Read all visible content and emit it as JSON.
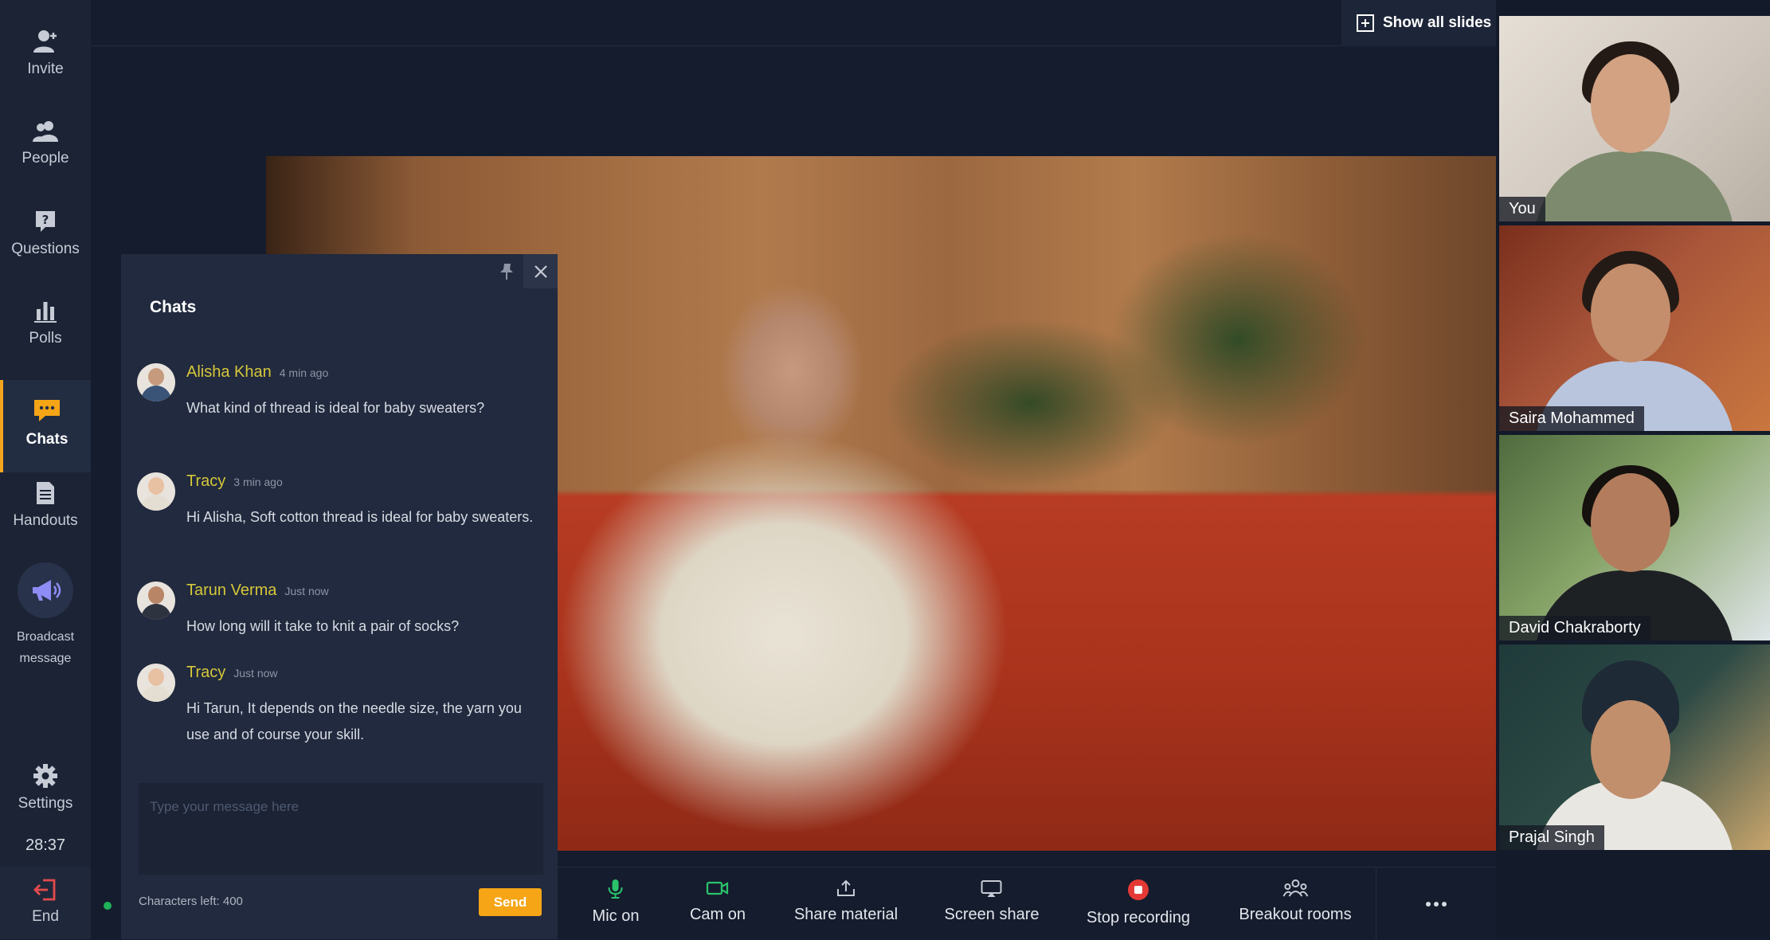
{
  "sidebar": {
    "items": [
      {
        "label": "Invite",
        "icon": "invite-icon"
      },
      {
        "label": "People",
        "icon": "people-icon"
      },
      {
        "label": "Questions",
        "icon": "question-icon"
      },
      {
        "label": "Polls",
        "icon": "polls-icon"
      },
      {
        "label": "Chats",
        "icon": "chat-icon",
        "active": true
      },
      {
        "label": "Handouts",
        "icon": "handouts-icon"
      }
    ],
    "broadcast": {
      "line1": "Broadcast",
      "line2": "message",
      "icon": "megaphone-icon"
    },
    "settings": {
      "label": "Settings",
      "icon": "gear-icon"
    },
    "timer": "28:37",
    "end": {
      "label": "End",
      "icon": "exit-icon"
    }
  },
  "topbar": {
    "show_all_slides": "Show all slides"
  },
  "chat": {
    "title": "Chats",
    "messages": [
      {
        "name": "Alisha Khan",
        "time": "4 min ago",
        "text": "What kind of thread is ideal for baby sweaters?"
      },
      {
        "name": "Tracy",
        "time": "3 min ago",
        "text": "Hi Alisha, Soft cotton thread is ideal for baby sweaters."
      },
      {
        "name": "Tarun Verma",
        "time": "Just now",
        "text": "How long will it take to knit a pair of socks?"
      },
      {
        "name": "Tracy",
        "time": "Just now",
        "text": "Hi Tarun, It depends on the needle size, the yarn you use and of course your skill."
      }
    ],
    "input_placeholder": "Type your message here",
    "chars_left": "Characters left: 400",
    "send_label": "Send"
  },
  "toolbar": {
    "items": [
      {
        "label": "Mic on",
        "icon": "mic-icon"
      },
      {
        "label": "Cam on",
        "icon": "camera-icon"
      },
      {
        "label": "Share material",
        "icon": "share-icon"
      },
      {
        "label": "Screen share",
        "icon": "screen-share-icon"
      },
      {
        "label": "Stop recording",
        "icon": "record-icon"
      },
      {
        "label": "Breakout rooms",
        "icon": "breakout-icon"
      }
    ],
    "more_icon": "more-icon"
  },
  "participants": [
    {
      "name": "You"
    },
    {
      "name": "Saira Mohammed"
    },
    {
      "name": "David Chakraborty"
    },
    {
      "name": "Prajal Singh"
    }
  ],
  "colors": {
    "accent": "#f5a516",
    "chat_name": "#d6c73a",
    "mic": "#2bc26b",
    "record": "#e53935"
  }
}
